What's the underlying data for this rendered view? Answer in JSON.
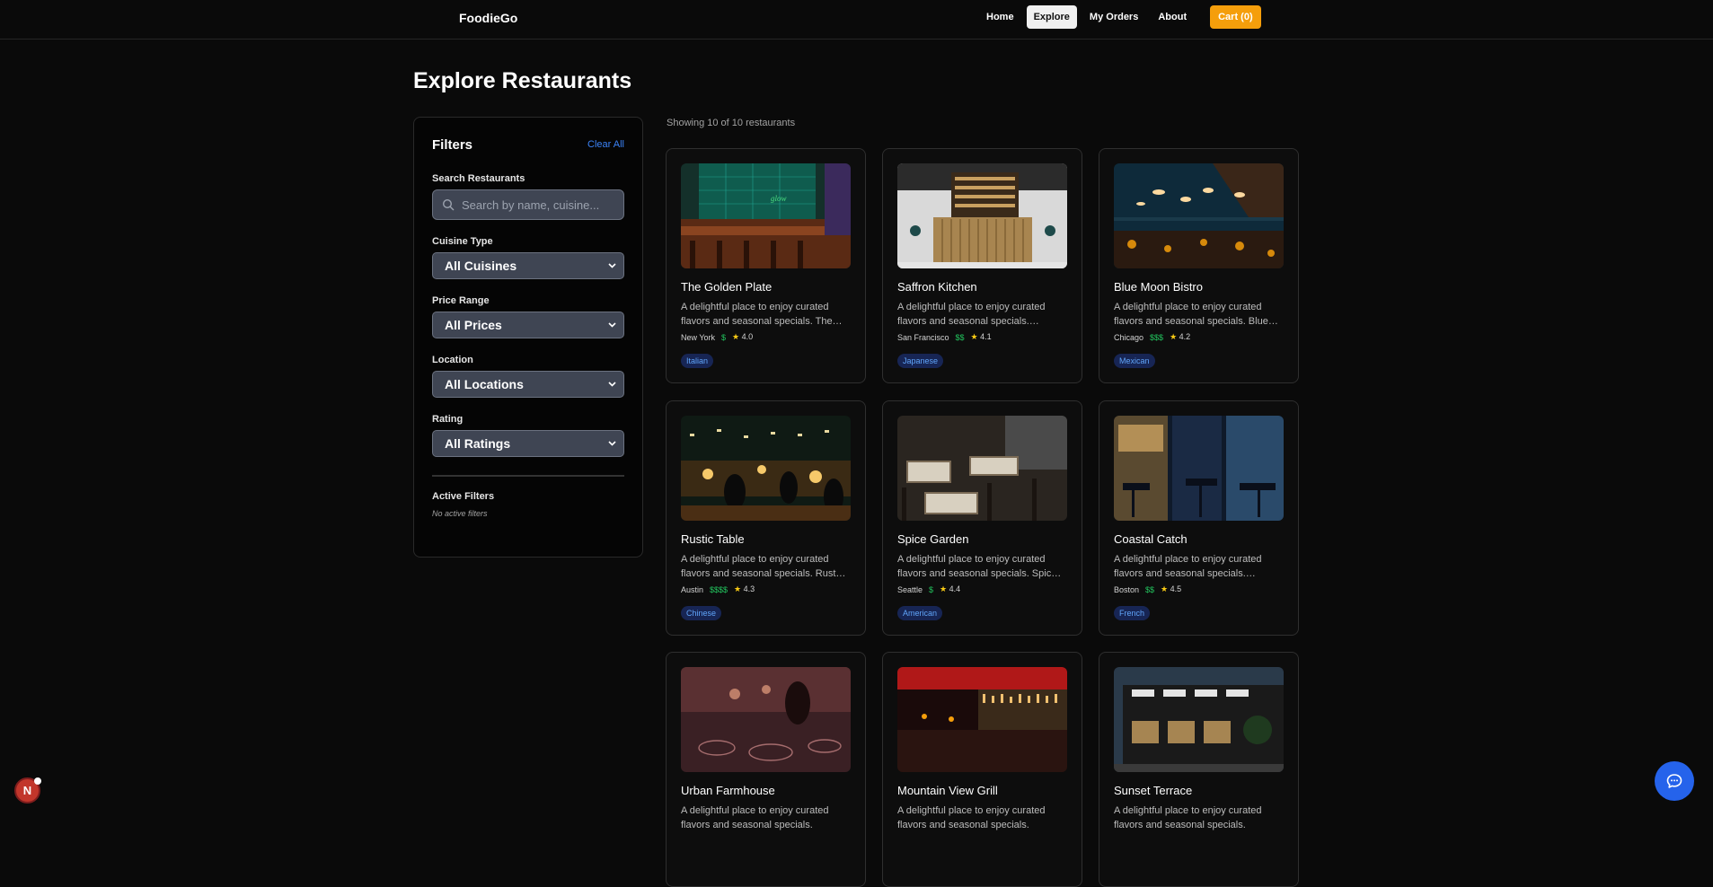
{
  "header": {
    "brand": "FoodieGo",
    "nav": [
      {
        "label": "Home",
        "active": false
      },
      {
        "label": "Explore",
        "active": true
      },
      {
        "label": "My Orders",
        "active": false
      },
      {
        "label": "About",
        "active": false
      }
    ],
    "cart_label": "Cart (0)",
    "accent": "#f59e0b"
  },
  "page_title": "Explore Restaurants",
  "filters": {
    "title": "Filters",
    "clear_label": "Clear All",
    "search_label": "Search Restaurants",
    "search_placeholder": "Search by name, cuisine...",
    "cuisine_label": "Cuisine Type",
    "cuisine_value": "All Cuisines",
    "price_label": "Price Range",
    "price_value": "All Prices",
    "location_label": "Location",
    "location_value": "All Locations",
    "rating_label": "Rating",
    "rating_value": "All Ratings",
    "active_title": "Active Filters",
    "active_none": "No active filters"
  },
  "results": {
    "showing": "Showing 10 of 10 restaurants",
    "restaurants": [
      {
        "name": "The Golden Plate",
        "desc": "A delightful place to enjoy curated flavors and seasonal specials. The…",
        "city": "New York",
        "price": "$",
        "rating": "4.0",
        "cuisine": "Italian"
      },
      {
        "name": "Saffron Kitchen",
        "desc": "A delightful place to enjoy curated flavors and seasonal specials.…",
        "city": "San Francisco",
        "price": "$$",
        "rating": "4.1",
        "cuisine": "Japanese"
      },
      {
        "name": "Blue Moon Bistro",
        "desc": "A delightful place to enjoy curated flavors and seasonal specials. Blue…",
        "city": "Chicago",
        "price": "$$$",
        "rating": "4.2",
        "cuisine": "Mexican"
      },
      {
        "name": "Rustic Table",
        "desc": "A delightful place to enjoy curated flavors and seasonal specials. Rust…",
        "city": "Austin",
        "price": "$$$$",
        "rating": "4.3",
        "cuisine": "Chinese"
      },
      {
        "name": "Spice Garden",
        "desc": "A delightful place to enjoy curated flavors and seasonal specials. Spic…",
        "city": "Seattle",
        "price": "$",
        "rating": "4.4",
        "cuisine": "American"
      },
      {
        "name": "Coastal Catch",
        "desc": "A delightful place to enjoy curated flavors and seasonal specials.…",
        "city": "Boston",
        "price": "$$",
        "rating": "4.5",
        "cuisine": "French"
      },
      {
        "name": "Urban Farmhouse",
        "desc": "A delightful place to enjoy curated flavors and seasonal specials.",
        "city": "",
        "price": "",
        "rating": "",
        "cuisine": ""
      },
      {
        "name": "Mountain View Grill",
        "desc": "A delightful place to enjoy curated flavors and seasonal specials.",
        "city": "",
        "price": "",
        "rating": "",
        "cuisine": ""
      },
      {
        "name": "Sunset Terrace",
        "desc": "A delightful place to enjoy curated flavors and seasonal specials.",
        "city": "",
        "price": "",
        "rating": "",
        "cuisine": ""
      }
    ]
  },
  "avatar_letter": "N"
}
